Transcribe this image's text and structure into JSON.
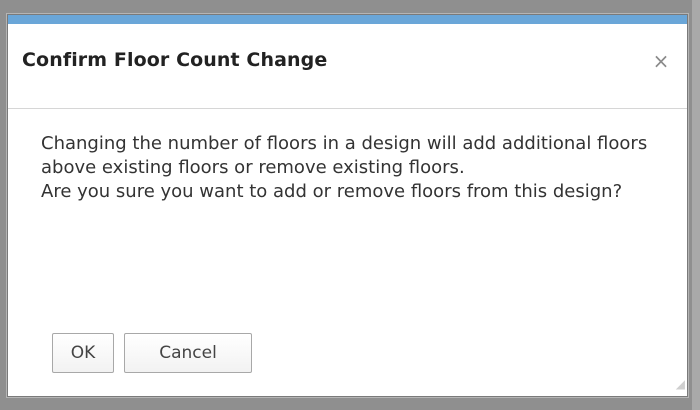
{
  "dialog": {
    "title": "Confirm Floor Count Change",
    "close_icon": "close-icon",
    "message_line1": "Changing the number of floors in a design will add additional floors above existing floors or remove existing floors.",
    "message_line2": "Are you sure you want to add or remove floors from this design?",
    "ok_label": "OK",
    "cancel_label": "Cancel"
  },
  "colors": {
    "accent": "#6aa6d8",
    "backdrop": "#8f8f8f",
    "dialog_bg": "#ffffff",
    "text": "#333333"
  }
}
